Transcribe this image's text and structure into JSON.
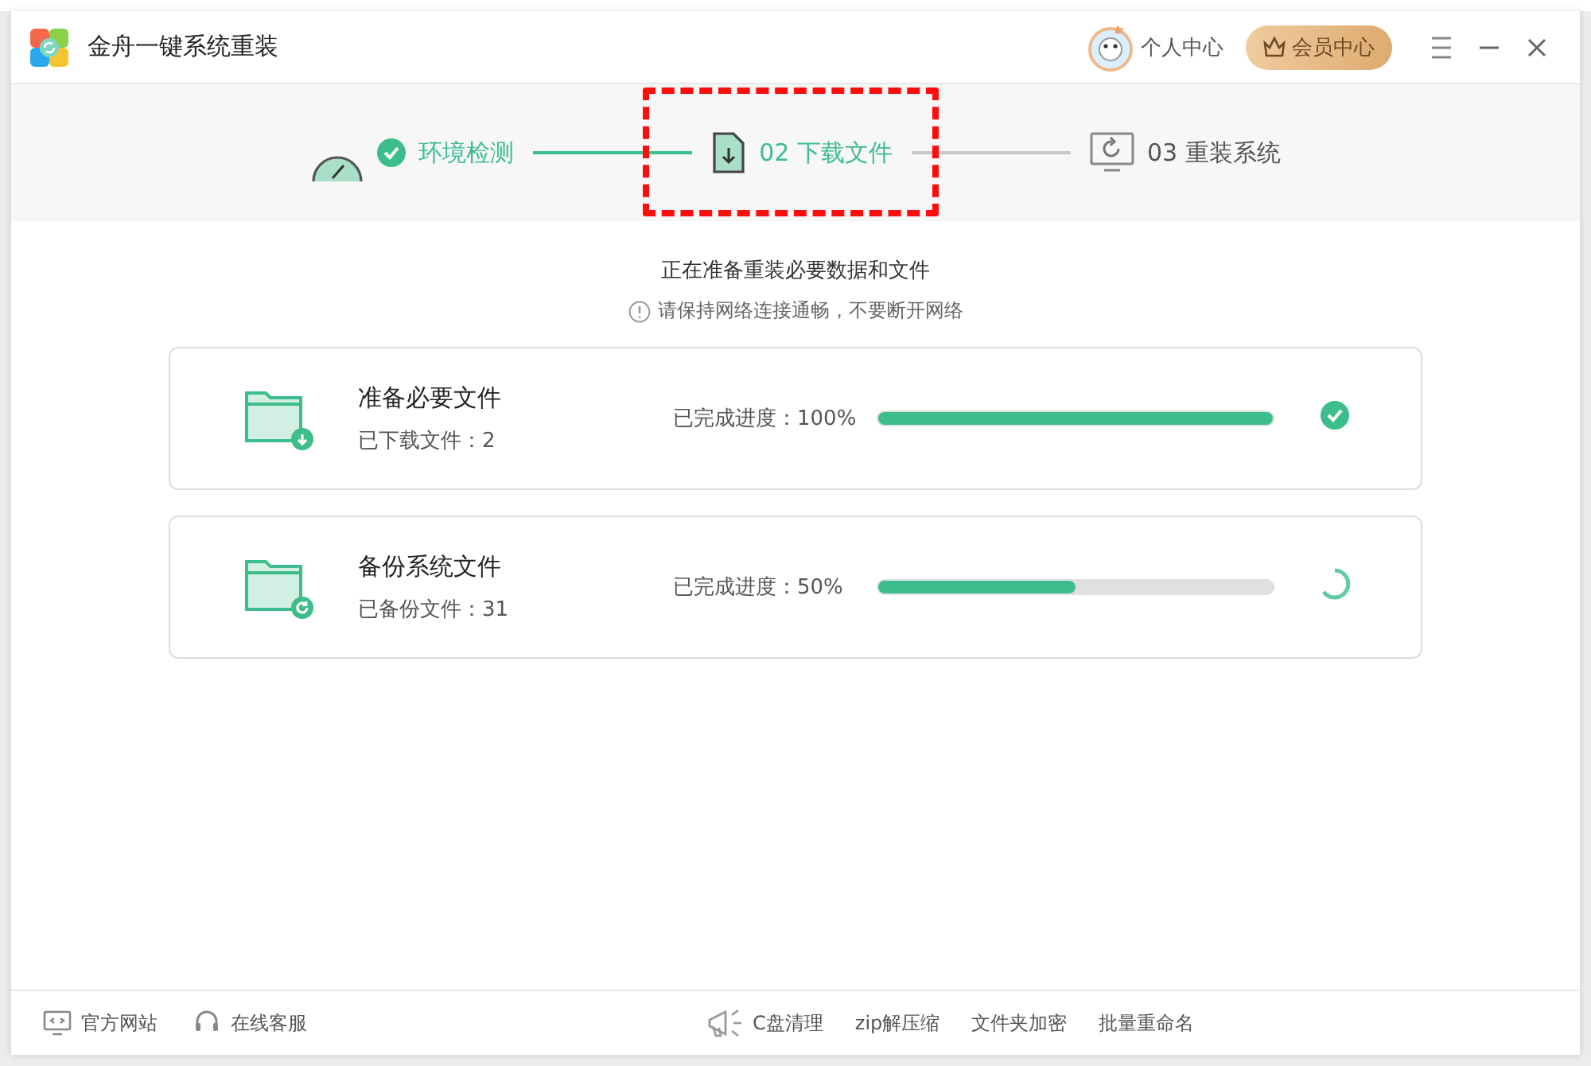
{
  "window": {
    "title": "金舟一键系统重装"
  },
  "header": {
    "profile": "个人中心",
    "vip_button": "会员中心"
  },
  "steps": [
    {
      "label": "环境检测",
      "kind": "done"
    },
    {
      "label": "02 下载文件",
      "kind": "active"
    },
    {
      "label": "03 重装系统",
      "kind": "pending"
    }
  ],
  "status": {
    "title": "正在准备重装必要数据和文件",
    "notice": "请保持网络连接通畅，不要断开网络"
  },
  "tasks": [
    {
      "name": "准备必要文件",
      "detail": "已下载文件：2",
      "progress_label": "已完成进度：100%",
      "level": 1,
      "kind": "download",
      "completed": true
    },
    {
      "name": "备份系统文件",
      "detail": "已备份文件：31",
      "progress_label": "已完成进度：50%",
      "level": 0.5,
      "kind": "backup",
      "completed": false
    }
  ],
  "footer": {
    "left": [
      {
        "label": "官方网站",
        "kind": "website"
      },
      {
        "label": "在线客服",
        "kind": "support"
      }
    ],
    "tools": [
      {
        "label": "C盘清理",
        "kind": "clean"
      },
      {
        "label": "zip解压缩"
      },
      {
        "label": "文件夹加密"
      },
      {
        "label": "批量重命名"
      }
    ]
  }
}
